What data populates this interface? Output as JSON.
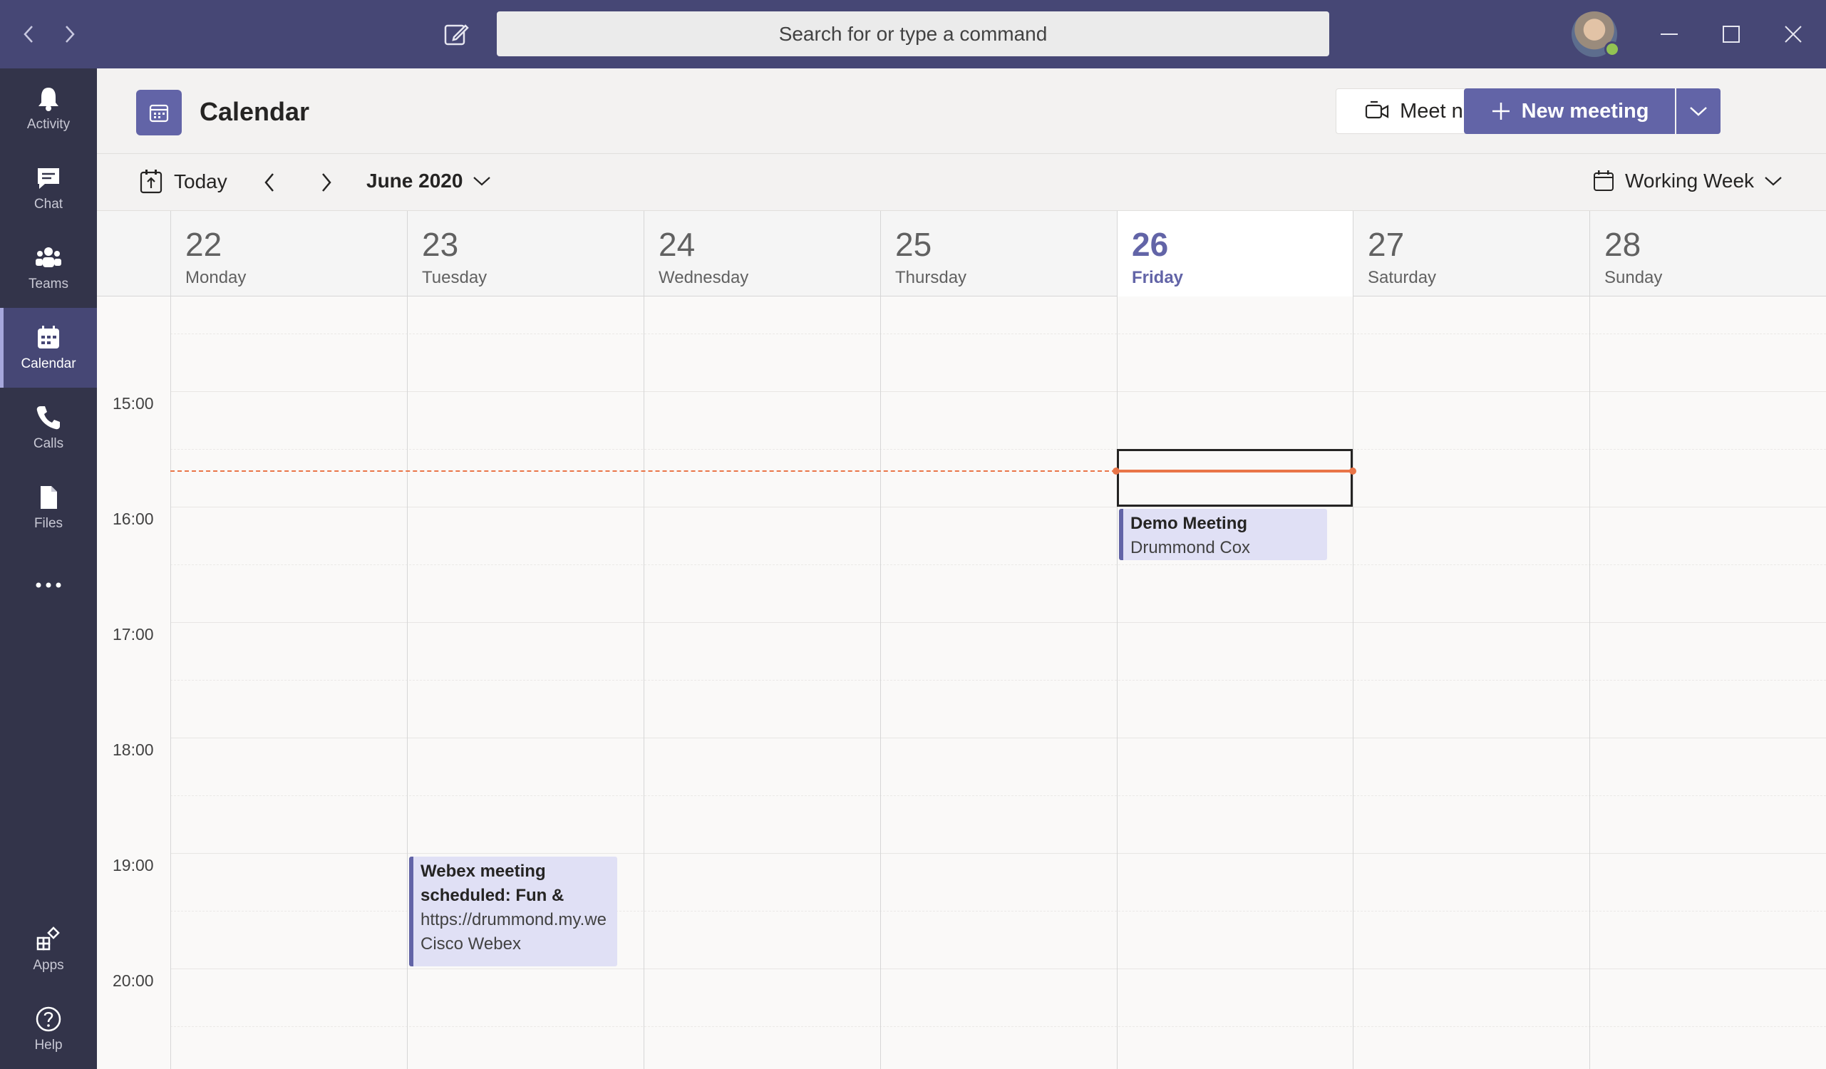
{
  "titlebar": {
    "search_placeholder": "Search for or type a command"
  },
  "rail": {
    "items": [
      {
        "label": "Activity",
        "icon": "bell-icon"
      },
      {
        "label": "Chat",
        "icon": "chat-icon"
      },
      {
        "label": "Teams",
        "icon": "teams-icon"
      },
      {
        "label": "Calendar",
        "icon": "calendar-icon"
      },
      {
        "label": "Calls",
        "icon": "phone-icon"
      },
      {
        "label": "Files",
        "icon": "file-icon"
      },
      {
        "label": "Apps",
        "icon": "apps-icon"
      },
      {
        "label": "Help",
        "icon": "help-icon"
      }
    ]
  },
  "header": {
    "title": "Calendar",
    "meet_now": "Meet now",
    "new_meeting": "New meeting"
  },
  "toolbar": {
    "today": "Today",
    "month": "June 2020",
    "view": "Working Week"
  },
  "days": [
    {
      "num": "22",
      "name": "Monday"
    },
    {
      "num": "23",
      "name": "Tuesday"
    },
    {
      "num": "24",
      "name": "Wednesday"
    },
    {
      "num": "25",
      "name": "Thursday"
    },
    {
      "num": "26",
      "name": "Friday"
    },
    {
      "num": "27",
      "name": "Saturday"
    },
    {
      "num": "28",
      "name": "Sunday"
    }
  ],
  "times": [
    "15:00",
    "16:00",
    "17:00",
    "18:00",
    "19:00",
    "20:00"
  ],
  "events": [
    {
      "title": "Demo Meeting",
      "organizer": "Drummond Cox"
    },
    {
      "title": "Webex meeting scheduled: Fun &",
      "link": "https://drummond.my.we",
      "organizer": "Cisco Webex"
    }
  ],
  "colors": {
    "accent": "#6264a7",
    "titlebar": "#464775",
    "rail": "#33344a",
    "now_line": "#e97548"
  }
}
